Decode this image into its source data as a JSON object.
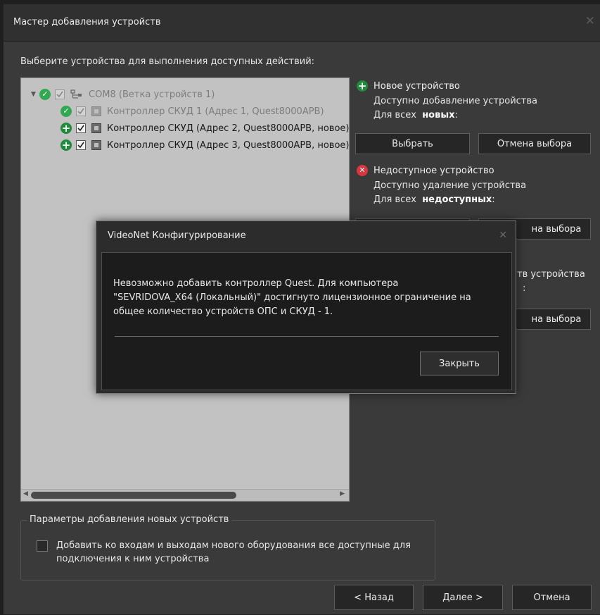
{
  "window": {
    "title": "Мастер добавления устройств",
    "close_glyph": "✕"
  },
  "instruction": "Выберите устройства для выполнения доступных действий:",
  "tree": {
    "root": {
      "label": "COM8 (Ветка устройств 1)",
      "status_icon": "check-circle-icon",
      "checked": true
    },
    "items": [
      {
        "label": "Контроллер СКУД 1 (Адрес 1, Quest8000APB)",
        "status_icon": "check-circle-icon",
        "checked": true,
        "dimmed": true
      },
      {
        "label": "Контроллер СКУД (Адрес 2, Quest8000APB, новое)",
        "status_icon": "plus-circle-icon",
        "checked": true,
        "dimmed": false
      },
      {
        "label": "Контроллер СКУД (Адрес 3, Quest8000APB, новое)",
        "status_icon": "plus-circle-icon",
        "checked": true,
        "dimmed": false
      }
    ]
  },
  "side": {
    "new": {
      "title": "Новое устройство",
      "desc": "Доступно добавление устройства",
      "for_all_prefix": "Для всех",
      "for_all_bold": "новых",
      "suffix": ":",
      "select_btn": "Выбрать",
      "cancel_btn": "Отмена выбора"
    },
    "unavailable": {
      "title": "Недоступное устройство",
      "desc": "Доступно удаление устройства",
      "for_all_prefix": "Для всех",
      "for_all_bold": "недоступных",
      "suffix": ":",
      "cancel_btn_visible": "на выбора"
    },
    "third": {
      "title_visible": "тв устройства",
      "suffix": ":",
      "cancel_btn_visible": "на выбора"
    }
  },
  "params": {
    "legend": "Параметры добавления новых устройств",
    "checkbox_text": "Добавить ко входам и выходам нового оборудования все доступные для подключения к ним устройства",
    "checked": false
  },
  "footer": {
    "back": "< Назад",
    "next": "Далее >",
    "cancel": "Отмена"
  },
  "modal": {
    "title": "VideoNet Конфигурирование",
    "close_glyph": "✕",
    "message": "Невозможно добавить контроллер Quest. Для компьютера\n\"SEVRIDOVA_X64 (Локальный)\" достигнуто лицензионное ограничение на\nобщее количество устройств ОПС и СКУД - 1.",
    "close_btn": "Закрыть"
  },
  "colors": {
    "ok": "#33a852",
    "add": "#1f8a3a",
    "error": "#d9363e"
  }
}
